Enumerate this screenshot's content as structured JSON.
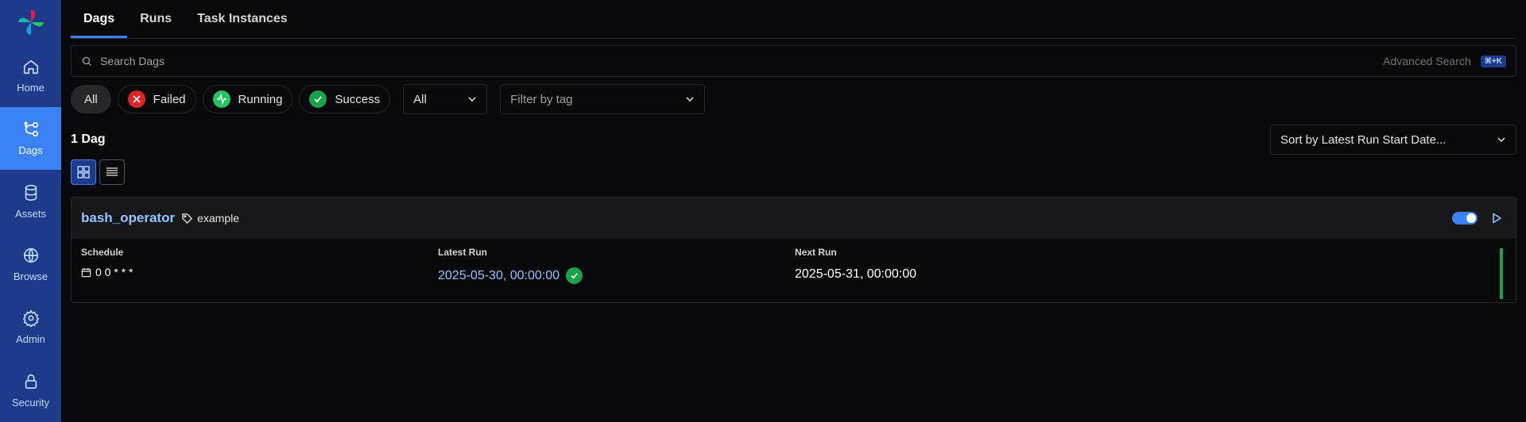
{
  "sidebar": {
    "items": [
      {
        "label": "Home"
      },
      {
        "label": "Dags"
      },
      {
        "label": "Assets"
      },
      {
        "label": "Browse"
      },
      {
        "label": "Admin"
      },
      {
        "label": "Security"
      }
    ]
  },
  "tabs": [
    {
      "label": "Dags"
    },
    {
      "label": "Runs"
    },
    {
      "label": "Task Instances"
    }
  ],
  "search": {
    "placeholder": "Search Dags",
    "advanced_label": "Advanced Search",
    "shortcut": "⌘+K"
  },
  "filters": {
    "all_label": "All",
    "failed_label": "Failed",
    "running_label": "Running",
    "success_label": "Success",
    "paused_select_value": "All",
    "tag_placeholder": "Filter by tag"
  },
  "list": {
    "count_label": "1 Dag",
    "sort_label": "Sort by Latest Run Start Date..."
  },
  "dag": {
    "dag_id": "bash_operator",
    "tag": "example",
    "schedule_label": "Schedule",
    "schedule_value": "0 0 * * *",
    "latest_run_label": "Latest Run",
    "latest_run_value": "2025-05-30, 00:00:00",
    "next_run_label": "Next Run",
    "next_run_value": "2025-05-31, 00:00:00"
  },
  "colors": {
    "sidebar_bg": "#1e3a8a",
    "accent": "#3b82f6",
    "failed": "#dc2626",
    "success": "#16a34a",
    "link": "#93c5fd"
  }
}
